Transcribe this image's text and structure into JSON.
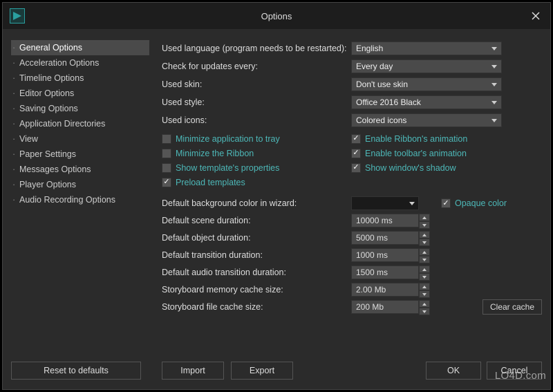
{
  "window": {
    "title": "Options"
  },
  "sidebar": {
    "items": [
      {
        "label": "General Options",
        "selected": true
      },
      {
        "label": "Acceleration Options"
      },
      {
        "label": "Timeline Options"
      },
      {
        "label": "Editor Options"
      },
      {
        "label": "Saving Options"
      },
      {
        "label": "Application Directories"
      },
      {
        "label": "View"
      },
      {
        "label": "Paper Settings"
      },
      {
        "label": "Messages Options"
      },
      {
        "label": "Player Options"
      },
      {
        "label": "Audio Recording Options"
      }
    ]
  },
  "main": {
    "language_label": "Used language (program needs to be restarted):",
    "language_value": "English",
    "updates_label": "Check for updates every:",
    "updates_value": "Every day",
    "skin_label": "Used skin:",
    "skin_value": "Don't use skin",
    "style_label": "Used style:",
    "style_value": "Office 2016 Black",
    "icons_label": "Used icons:",
    "icons_value": "Colored icons",
    "checkboxes_left": [
      {
        "label": "Minimize application to tray",
        "checked": false
      },
      {
        "label": "Minimize the Ribbon",
        "checked": false
      },
      {
        "label": "Show template's properties",
        "checked": false
      },
      {
        "label": "Preload templates",
        "checked": true
      }
    ],
    "checkboxes_right": [
      {
        "label": "Enable Ribbon's animation",
        "checked": true
      },
      {
        "label": "Enable toolbar's animation",
        "checked": true
      },
      {
        "label": "Show window's shadow",
        "checked": true
      }
    ],
    "bgcolor_label": "Default background color in wizard:",
    "bgcolor_value": "#000000",
    "opaque_label": "Opaque color",
    "opaque_checked": true,
    "spinners": [
      {
        "label": "Default scene duration:",
        "value": "10000 ms"
      },
      {
        "label": "Default object duration:",
        "value": "5000 ms"
      },
      {
        "label": "Default transition duration:",
        "value": "1000 ms"
      },
      {
        "label": "Default audio transition duration:",
        "value": "1500 ms"
      },
      {
        "label": "Storyboard memory cache size:",
        "value": "2.00 Mb"
      },
      {
        "label": "Storyboard file cache size:",
        "value": "200 Mb"
      }
    ],
    "clear_cache": "Clear cache"
  },
  "buttons": {
    "reset": "Reset to defaults",
    "import": "Import",
    "export": "Export",
    "ok": "OK",
    "cancel": "Cancel"
  },
  "watermark": "LO4D.com"
}
